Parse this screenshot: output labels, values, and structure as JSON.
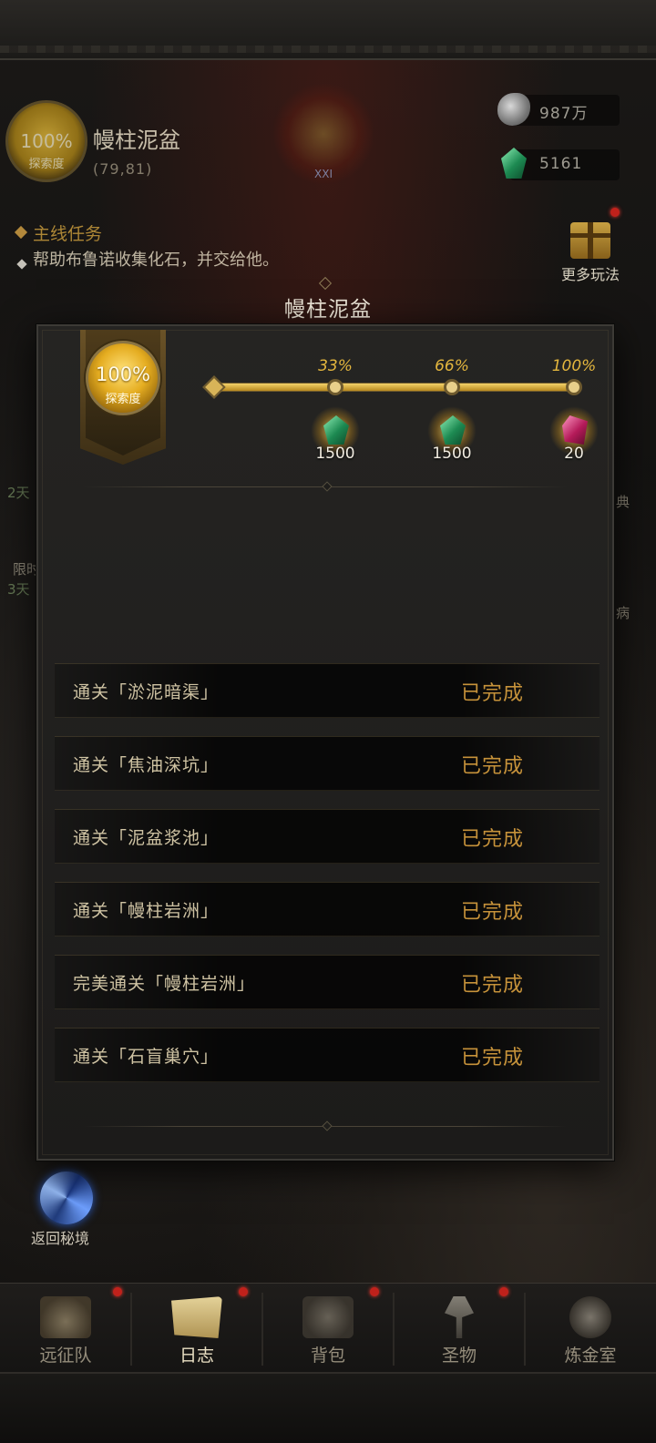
{
  "zone": {
    "name": "幔柱泥盆",
    "coords": "(79,81)",
    "explore_pct": "100%",
    "explore_label": "探索度",
    "boss_numeral": "XXI"
  },
  "resources": [
    {
      "icon": "ore-icon",
      "value": "987万"
    },
    {
      "icon": "green-gem-icon",
      "value": "5161"
    }
  ],
  "quest": {
    "title": "主线任务",
    "desc": "帮助布鲁诺收集化石，并交给他。"
  },
  "more_play": {
    "label": "更多玩法"
  },
  "side_fragments": [
    "2天",
    "限时",
    "3天",
    "典",
    "病"
  ],
  "modal": {
    "title": "幔柱泥盆",
    "explore_pct": "100%",
    "explore_label": "探索度",
    "progress_fraction": 1.0,
    "milestones": [
      {
        "pct": "33%",
        "reward_icon": "green-gem-icon",
        "amount": "1500"
      },
      {
        "pct": "66%",
        "reward_icon": "green-gem-icon",
        "amount": "1500"
      },
      {
        "pct": "100%",
        "reward_icon": "pink-crystal-icon",
        "amount": "20"
      }
    ],
    "tasks": [
      {
        "name": "通关「淤泥暗渠」",
        "status": "已完成"
      },
      {
        "name": "通关「焦油深坑」",
        "status": "已完成"
      },
      {
        "name": "通关「泥盆浆池」",
        "status": "已完成"
      },
      {
        "name": "通关「幔柱岩洲」",
        "status": "已完成"
      },
      {
        "name": "完美通关「幔柱岩洲」",
        "status": "已完成"
      },
      {
        "name": "通关「石盲巢穴」",
        "status": "已完成"
      }
    ]
  },
  "return_portal": {
    "label": "返回秘境"
  },
  "bottom_nav": [
    {
      "label": "远征队",
      "icon": "viking-helmet-icon",
      "active": false
    },
    {
      "label": "日志",
      "icon": "scroll-icon",
      "active": true
    },
    {
      "label": "背包",
      "icon": "backpack-icon",
      "active": false
    },
    {
      "label": "圣物",
      "icon": "torch-icon",
      "active": false
    },
    {
      "label": "炼金室",
      "icon": "alchemy-icon",
      "active": false
    }
  ],
  "colors": {
    "accent_gold": "#c6923a",
    "progress_gold": "#e3b63e",
    "notify_red": "#c0211b"
  }
}
